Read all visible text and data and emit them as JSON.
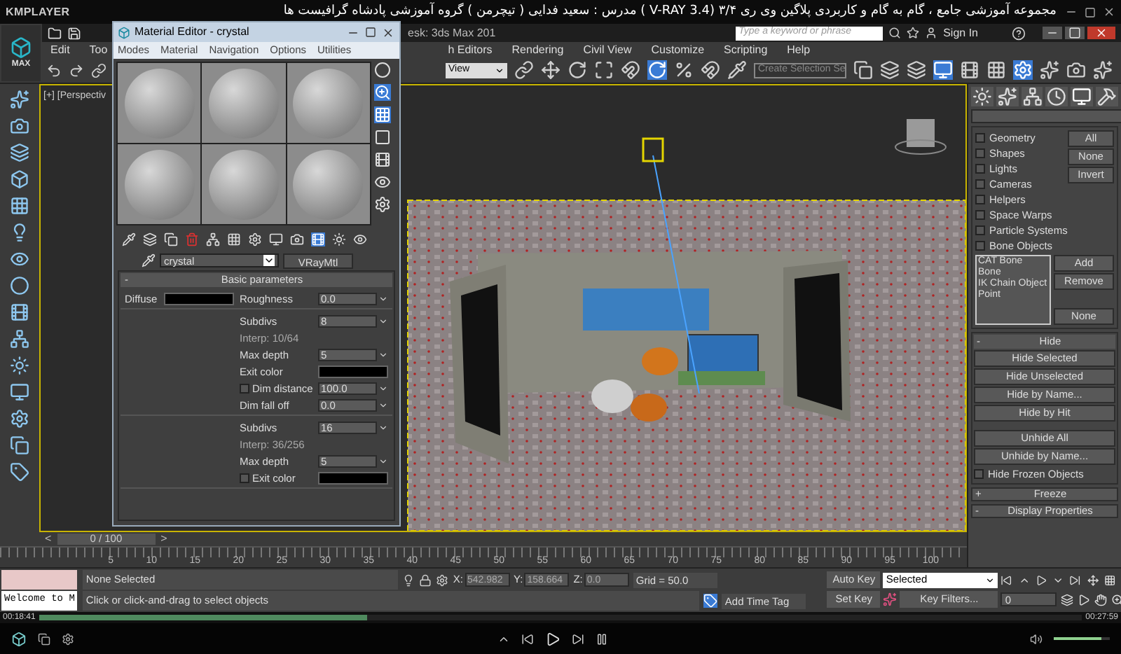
{
  "player": {
    "brand": "KMPLAYER",
    "title": "مجموعه آموزشی جامع ، گام به گام و کاربردی پلاگین وی ری ۳/۴ (V-RAY 3.4 )  مدرس : سعید فدایی ( تیچرمن ) گروه آموزشی پادشاه گرافیست ها",
    "time_elapsed": "00:18:41",
    "time_total": "00:27:59",
    "progress": {
      "level": 0.315
    },
    "volume": {
      "level": 0.85
    }
  },
  "app": {
    "title": "esk: 3ds Max 201",
    "logo_label": "MAX",
    "search": {
      "placeholder": "Type a keyword or phrase"
    },
    "sign_in": "Sign In",
    "menu_left": [
      "Edit",
      "Too"
    ],
    "menu_right": [
      "h Editors",
      "Rendering",
      "Civil View",
      "Customize",
      "Scripting",
      "Help"
    ],
    "toolbar": {
      "view_dropdown": "View",
      "selection_set": "Create Selection Se"
    },
    "viewport": {
      "label": "[+] [Perspectiv"
    }
  },
  "material_editor": {
    "title": "Material Editor - crystal",
    "menu": [
      "Modes",
      "Material",
      "Navigation",
      "Options",
      "Utilities"
    ],
    "material_name": "crystal",
    "material_type": "VRayMtl",
    "rollout": {
      "sign": "-",
      "title": "Basic parameters"
    },
    "sections": [
      {
        "left": [
          {
            "kind": "swatch",
            "label": "Diffuse"
          }
        ],
        "right": [
          {
            "kind": "spinner",
            "label": "Roughness",
            "value": "0.0"
          }
        ]
      },
      {
        "right": [
          {
            "kind": "spinner",
            "label": "Subdivs",
            "value": "8"
          },
          {
            "kind": "text",
            "label": "Interp: 10/64"
          },
          {
            "kind": "spinner",
            "label": "Max depth",
            "value": "5"
          },
          {
            "kind": "swatch",
            "label": "Exit color"
          },
          {
            "kind": "checkspinner",
            "label": "Dim distance",
            "checked": false,
            "value": "100.0"
          },
          {
            "kind": "spinner",
            "label": "Dim fall off",
            "value": "0.0"
          }
        ]
      },
      {
        "right": [
          {
            "kind": "spinner",
            "label": "Subdivs",
            "value": "16"
          },
          {
            "kind": "text",
            "label": "Interp: 36/256"
          },
          {
            "kind": "spinner",
            "label": "Max depth",
            "value": "5"
          },
          {
            "kind": "checkswatch",
            "label": "Exit color",
            "checked": false
          }
        ]
      }
    ]
  },
  "command_panel": {
    "filters": [
      {
        "label": "Geometry",
        "checked": false
      },
      {
        "label": "Shapes",
        "checked": false
      },
      {
        "label": "Lights",
        "checked": false
      },
      {
        "label": "Cameras",
        "checked": false
      },
      {
        "label": "Helpers",
        "checked": false
      },
      {
        "label": "Space Warps",
        "checked": false
      },
      {
        "label": "Particle Systems",
        "checked": false
      },
      {
        "label": "Bone Objects",
        "checked": false
      }
    ],
    "filter_buttons": [
      "All",
      "None",
      "Invert"
    ],
    "list_items": [
      "CAT Bone",
      "Bone",
      "IK Chain Object",
      "Point"
    ],
    "list_buttons": [
      "Add",
      "Remove"
    ],
    "list_clear": "None",
    "hide_rollout": {
      "sign": "-",
      "title": "Hide",
      "button_groups": [
        [
          "Hide Selected",
          "Hide Unselected",
          "Hide by Name...",
          "Hide by Hit"
        ],
        [
          "Unhide All",
          "Unhide by Name..."
        ]
      ],
      "checkbox": {
        "label": "Hide Frozen Objects",
        "checked": false
      }
    },
    "rollouts": [
      {
        "sign": "+",
        "title": "Freeze"
      },
      {
        "sign": "-",
        "title": "Display Properties"
      }
    ]
  },
  "timeline": {
    "prev": "<",
    "label": "0 / 100",
    "next": ">",
    "ticks": [
      "5",
      "10",
      "15",
      "20",
      "25",
      "30",
      "35",
      "40",
      "45",
      "50",
      "55",
      "60",
      "65",
      "70",
      "75",
      "80",
      "85",
      "90",
      "95",
      "100"
    ]
  },
  "status": {
    "welcome": "Welcome to M",
    "selection": "None Selected",
    "prompt": "Click or click-and-drag to select objects",
    "coords": [
      {
        "axis": "X:",
        "value": "542.982"
      },
      {
        "axis": "Y:",
        "value": "158.664"
      },
      {
        "axis": "Z:",
        "value": "0.0"
      }
    ],
    "grid": "Grid = 50.0",
    "time_tag": "Add Time Tag",
    "auto_key": "Auto Key",
    "key_mode": "Selected",
    "set_key": "Set Key",
    "key_filters": "Key Filters...",
    "frame": "0"
  }
}
